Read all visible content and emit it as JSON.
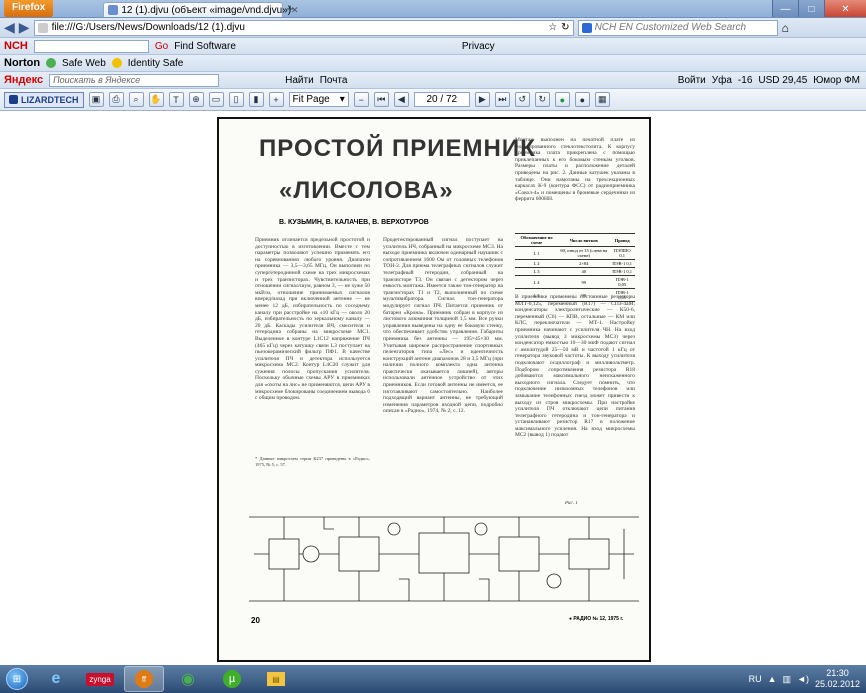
{
  "browser": {
    "app_button": "Firefox",
    "tab_title": "12 (1).djvu (объект «image/vnd.djvu»)",
    "new_tab": "+",
    "url": "file:///G:/Users/News/Downloads/12 (1).djvu",
    "search_placeholder": "NCH EN Customized Web Search"
  },
  "toolbars": {
    "nch": {
      "logo": "NCH",
      "go": "Go",
      "find": "Find Software",
      "privacy": "Privacy"
    },
    "norton": {
      "logo": "Norton",
      "safe_web": "Safe Web",
      "identity_safe": "Identity Safe"
    },
    "yandex": {
      "logo": "Яндекс",
      "search_placeholder": "Поискать в Яндексе",
      "find": "Найти",
      "mail": "Почта",
      "login": "Войти",
      "city": "Уфа",
      "temp": "-16",
      "currency": "USD 29,45",
      "radio": "Юмор ФМ"
    }
  },
  "djvu_toolbar": {
    "brand": "LIZARDTECH",
    "zoom": "Fit Page",
    "page": "20 / 72"
  },
  "document": {
    "title_line1": "ПРОСТОЙ ПРИЕМНИК",
    "title_line2": "«ЛИСОЛОВА»",
    "authors": "В. КУЗЬМИН, В. КАЛАЧЕВ, В. ВЕРХОТУРОВ",
    "col1": "Приемник отличается предельной простотой и доступностью в изготовлении. Вместе с тем параметры позволяют успешно применять его на соревнованиях любого уровня. Диапазон приемника — 3,5—3,65 МГц. Он выполнен по супергетеродинной схеме на трех микросхемах и трех транзисторах. Чувствительность при отношении сигнал/шум, равном 3, — не хуже 50 мкВ/м, отношение принимаемых сигналов вперед/назад при включенной антенне — не менее 12 дБ, избирательность по соседнему каналу при расстройке на ±10 кГц — около 20 дБ, избирательность по зеркальному каналу — 20 дБ. Каскады усилителя ВЧ, смесителя и гетеродина собраны на микросхеме МС1. Выделенное в контуре L1C12 напряжение ПЧ (465 кГц) через катушку связи L3 поступает на пьезокерамический фильтр ПФ1. В качестве усилителя ПЧ и детектора используется микросхема МС2. Контур L4C20 служит для сужения полосы пропускания усилителя. Поскольку обычные схемы АРУ в приемниках для «охоты на лис» не применяются, цепи АРУ в микросхеме блокированы соединением вывода 6 с общим проводом.",
    "col2": "Продетектированный сигнал поступает на усилитель НЧ, собранный на микросхеме МС3. На выходе приемника включен одинарный наушник с сопротивлением 1600 Ом от головных телефонов ТОН-2. Для приема телеграфных сигналов служит телеграфный гетеродин, собранный на транзисторе Т3. Он связан с детектором через емкость монтажа. Имеется также тон-генератор на транзисторах Т1 и Т2, выполненный по схеме мультивибратора. Сигнал тон-генератора модулирует сигнал ПЧ. Питается приемник от батареи «Крона». Приемник собран в корпусе из листового алюминия толщиной 1,5 мм. Все ручки управления выведены на одну ее боковую стенку, что обеспечивает удобство управления. Габариты приемника без антенны — 195×45×30 мм. Учитывая широкое распространение спортивных пеленгаторов типа «Лес» и идентичность конструкций антенн диапазонов 28 и 3,5 МГц (при наличии полного комплекта одна антенна практически оказывается лишней), авторы использовали антенное устройство от этих приемников. Если готовой антенны не имеется, ее изготавливают самостоятельно. Наиболее подходящий вариант антенны, не требующий изменения параметров входной цепи, подробно описан в «Радио», 1974, № 2, с. 12.",
    "col3": "Монтаж выполнен на печатной плате из фольгированного стеклотекстолита. К корпусу приемника плата прикреплена с помощью приклепанных к его боковым стенкам уголков. Размеры платы и расположение деталей приведены на рис. 2. Данные катушек указаны в таблице. Они намотаны на трехсекционных каркасах К-9 (контура ФСС) от радиоприемника «Сокол-4» и помещены в броневые сердечники из феррита 600НН.",
    "col4": "В приемнике применены постоянные резисторы МЛТ-0,125, переменный (R17) — СПЗ-4аМ; конденсаторы электролитические — К50-6, переменный (C6) — КПВ, остальные — КМ или КЛС, переключатели — МТ-1. Настройку приемника начинают с усилителя ЧН. На вход усилителя (вывод 3 микросхемы МС3) через конденсатор емкостью 10—30 мкФ подают сигнал с амплитудой 25—50 мВ и частотой 1 кГц от генератора звуковой частоты. К выходу усилителя подключают осциллограф и милливольтметр. Подбором сопротивления резистора R18 добиваются максимального неискаженного выходного сигнала. Следует помнить, что подключение низкоомных телефонов или замыкание телефонных гнезд может привести к выходу из строя микросхемы. При настройке усилителя ПЧ отключают цепи питания телеграфного гетеродина и тон-генератора и устанавливают резистор R17 в положение максимального усиления. На вход микросхемы МС2 (вывод 1) подают",
    "footnote": "* Данные микросхем серии К237 приведены в «Радио», 1975, № 5, с. 57.",
    "table": {
      "headers": [
        "Обозначение по схеме",
        "Число витков",
        "Провод"
      ],
      "rows": [
        [
          "L 1",
          "60, отвод от 15 (слева на схеме)",
          "ПЭЛШО 0,1"
        ],
        [
          "L 2",
          "2×84",
          "ПЭВ-1 0,1"
        ],
        [
          "L 3",
          "40",
          "ПЭВ-1 0,1"
        ],
        [
          "L 4",
          "99",
          "ПЭВ-1 0,05"
        ],
        [
          "L 5",
          "99",
          "ПЭВ-1 0,05"
        ]
      ]
    },
    "figure_caption": "Рис. 1",
    "page_number": "20",
    "page_footer": "● РАДИО № 12, 1975 г."
  },
  "taskbar": {
    "start": "⊞",
    "lang": "RU",
    "time": "21:30",
    "date": "25.02.2012",
    "apps": [
      {
        "name": "ie",
        "label": "e"
      },
      {
        "name": "zynga",
        "label": "zynga"
      },
      {
        "name": "firefox",
        "label": "ff"
      },
      {
        "name": "chrome",
        "label": "◉"
      },
      {
        "name": "utorrent",
        "label": "µ"
      },
      {
        "name": "explorer",
        "label": "▤"
      }
    ]
  },
  "colors": {
    "accent": "#2b4a73",
    "firefox_orange": "#e07a14"
  }
}
